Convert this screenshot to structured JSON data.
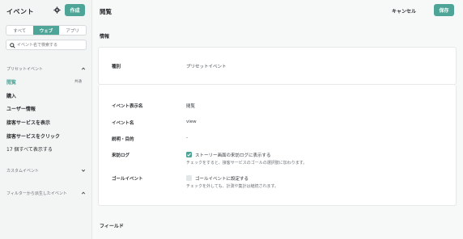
{
  "sidebar": {
    "title": "イベント",
    "create_label": "作成",
    "tabs": [
      "すべて",
      "ウェブ",
      "アプリ"
    ],
    "active_tab": 1,
    "search_placeholder": "イベント名で検索する",
    "sections": {
      "preset": "プリセットイベント",
      "custom": "カスタムイベント",
      "filter": "フィルターから派生したイベント"
    },
    "items": [
      {
        "label": "閲覧",
        "badge": "共通",
        "active": true
      },
      {
        "label": "購入"
      },
      {
        "label": "ユーザー情報"
      },
      {
        "label": "接客サービスを表示"
      },
      {
        "label": "接客サービスをクリック"
      },
      {
        "label": "17 個すべて表示する"
      }
    ]
  },
  "header": {
    "title": "閲覧",
    "cancel_label": "キャンセル",
    "save_label": "保存"
  },
  "info": {
    "section_title": "情報",
    "type_label": "種別",
    "type_value": "プリセットイベント",
    "display_name_label": "イベント表示名",
    "display_name_value": "閲覧",
    "event_name_label": "イベント名",
    "event_name_value": "view",
    "description_label": "説明・目的",
    "description_value": "-",
    "visit_log_label": "来訪ログ",
    "visit_log_checkbox": "ストーリー画面の来訪ログに表示する",
    "visit_log_checked": true,
    "visit_log_hint": "チェックをすると、接客サービスのゴールの選択肢に加わります。",
    "goal_label": "ゴールイベント",
    "goal_checkbox": "ゴールイベントに設定する",
    "goal_checked": false,
    "goal_hint": "チェックを外しても、計測や集計は継続されます。"
  },
  "fields": {
    "section_title": "フィールド"
  },
  "colors": {
    "accent": "#4ea597"
  }
}
